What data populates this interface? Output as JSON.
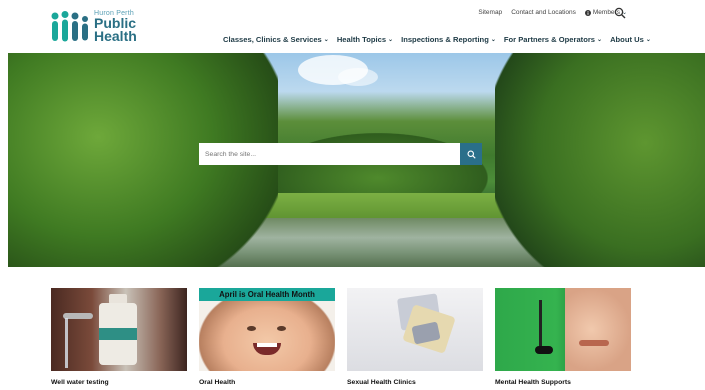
{
  "header": {
    "logo": {
      "line1": "Huron Perth",
      "line2": "Public",
      "line3": "Health"
    },
    "utility": {
      "sitemap": "Sitemap",
      "contact": "Contact and Locations",
      "members": "Members"
    },
    "nav": [
      {
        "label": "Classes, Clinics & Services"
      },
      {
        "label": "Health Topics"
      },
      {
        "label": "Inspections & Reporting"
      },
      {
        "label": "For Partners & Operators"
      },
      {
        "label": "About Us"
      }
    ]
  },
  "hero": {
    "search": {
      "placeholder": "Search the site..."
    }
  },
  "cards": [
    {
      "title": "Well water testing",
      "icon": "water-sample-photo"
    },
    {
      "title": "Oral Health",
      "banner": "April is Oral Health Month",
      "icon": "child-smile-photo"
    },
    {
      "title": "Sexual Health Clinics",
      "icon": "pill-pack-photo"
    },
    {
      "title": "Mental Health Supports",
      "icon": "headset-person-photo"
    }
  ],
  "colors": {
    "brand_dark": "#2a6f84",
    "brand_light": "#5aa0b5",
    "accent": "#1aa79a",
    "search_button": "#2a6f8a"
  }
}
